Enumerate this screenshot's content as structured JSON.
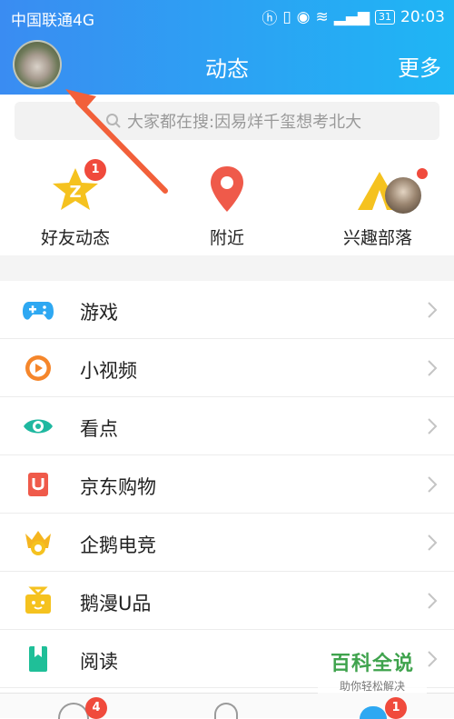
{
  "status_bar": {
    "carrier": "中国联通4G",
    "time": "20:03",
    "battery": "31"
  },
  "header": {
    "title": "动态",
    "more": "更多"
  },
  "search": {
    "placeholder": "大家都在搜:因易烊千玺想考北大"
  },
  "shortcuts": [
    {
      "label": "好友动态",
      "icon": "star-z-icon",
      "badge": "1"
    },
    {
      "label": "附近",
      "icon": "location-pin-icon"
    },
    {
      "label": "兴趣部落",
      "icon": "tent-icon"
    }
  ],
  "menu": [
    {
      "label": "游戏",
      "icon": "gamepad-icon",
      "color": "#2ea8f2"
    },
    {
      "label": "小视频",
      "icon": "play-icon",
      "color": "#f5862b"
    },
    {
      "label": "看点",
      "icon": "eye-icon",
      "color": "#1fb8a0"
    },
    {
      "label": "京东购物",
      "icon": "jd-bag-icon",
      "color": "#ef5a4a"
    },
    {
      "label": "企鹅电竞",
      "icon": "crown-icon",
      "color": "#f5b51f"
    },
    {
      "label": "鹅漫U品",
      "icon": "gift-icon",
      "color": "#f5c21f"
    },
    {
      "label": "阅读",
      "icon": "book-icon",
      "color": "#1fbf98"
    }
  ],
  "tabbar": {
    "messages_badge": "4",
    "dynamic_badge": "1"
  },
  "watermark": {
    "title": "百科全说",
    "subtitle": "助你轻松解决"
  },
  "colors": {
    "header_start": "#3a8cf2",
    "header_end": "#1fb6f4",
    "badge": "#f04a3c",
    "arrow": "#f2603a"
  }
}
